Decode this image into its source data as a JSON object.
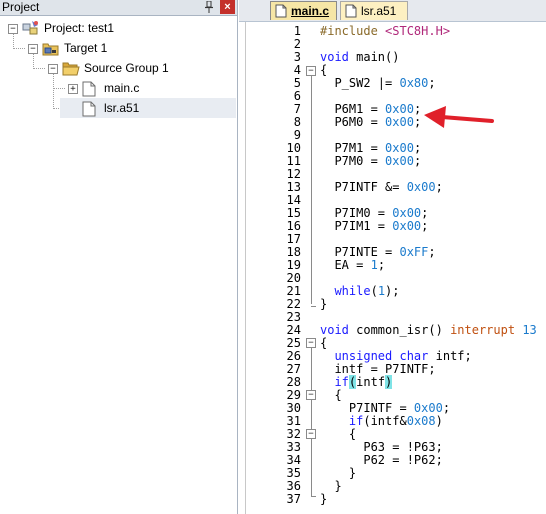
{
  "project_panel": {
    "title": "Project",
    "pin_glyph": "📌",
    "close_glyph": "×",
    "tree": {
      "project_label": "Project: test1",
      "target_label": "Target 1",
      "group_label": "Source Group 1",
      "files": [
        "main.c",
        "lsr.a51"
      ]
    }
  },
  "editor": {
    "tabs": [
      {
        "label": "main.c",
        "active": true
      },
      {
        "label": "lsr.a51",
        "active": false
      }
    ],
    "line_numbers": [
      "1",
      "2",
      "3",
      "4",
      "5",
      "6",
      "7",
      "8",
      "9",
      "10",
      "11",
      "12",
      "13",
      "14",
      "15",
      "16",
      "17",
      "18",
      "19",
      "20",
      "21",
      "22",
      "23",
      "24",
      "25",
      "26",
      "27",
      "28",
      "29",
      "30",
      "31",
      "32",
      "33",
      "34",
      "35",
      "36",
      "37"
    ],
    "code_lines": [
      "#include <STC8H.H>",
      "",
      "void main()",
      "{",
      "  P_SW2 |= 0x80;",
      "",
      "  P6M1 = 0x00;",
      "  P6M0 = 0x00;",
      "",
      "  P7M1 = 0x00;",
      "  P7M0 = 0x00;",
      "",
      "  P7INTF &= 0x00;",
      "",
      "  P7IM0 = 0x00;",
      "  P7IM1 = 0x00;",
      "",
      "  P7INTE = 0xFF;",
      "  EA = 1;",
      "",
      "  while(1);",
      "}",
      "",
      "void common_isr() interrupt 13",
      "{",
      "  unsigned char intf;",
      "  intf = P7INTF;",
      "  if(intf)",
      "  {",
      "    P7INTF = 0x00;",
      "    if(intf&0x08)",
      "    {",
      "      P63 = !P63;",
      "      P62 = !P62;",
      "    }",
      "  }",
      "}"
    ],
    "annotation": {
      "type": "red-arrow",
      "color": "#e0202a"
    }
  },
  "colors": {
    "keyword": "#1a1aff",
    "number": "#1a7acc",
    "include": "#8a6a2a",
    "header": "#b0287a",
    "interrupt": "#c05010",
    "bracket_highlight": "#7fe3e6",
    "tab_active": "#f6e6a6",
    "tab_inactive": "#fdf0c2",
    "close_button": "#c4302b"
  }
}
